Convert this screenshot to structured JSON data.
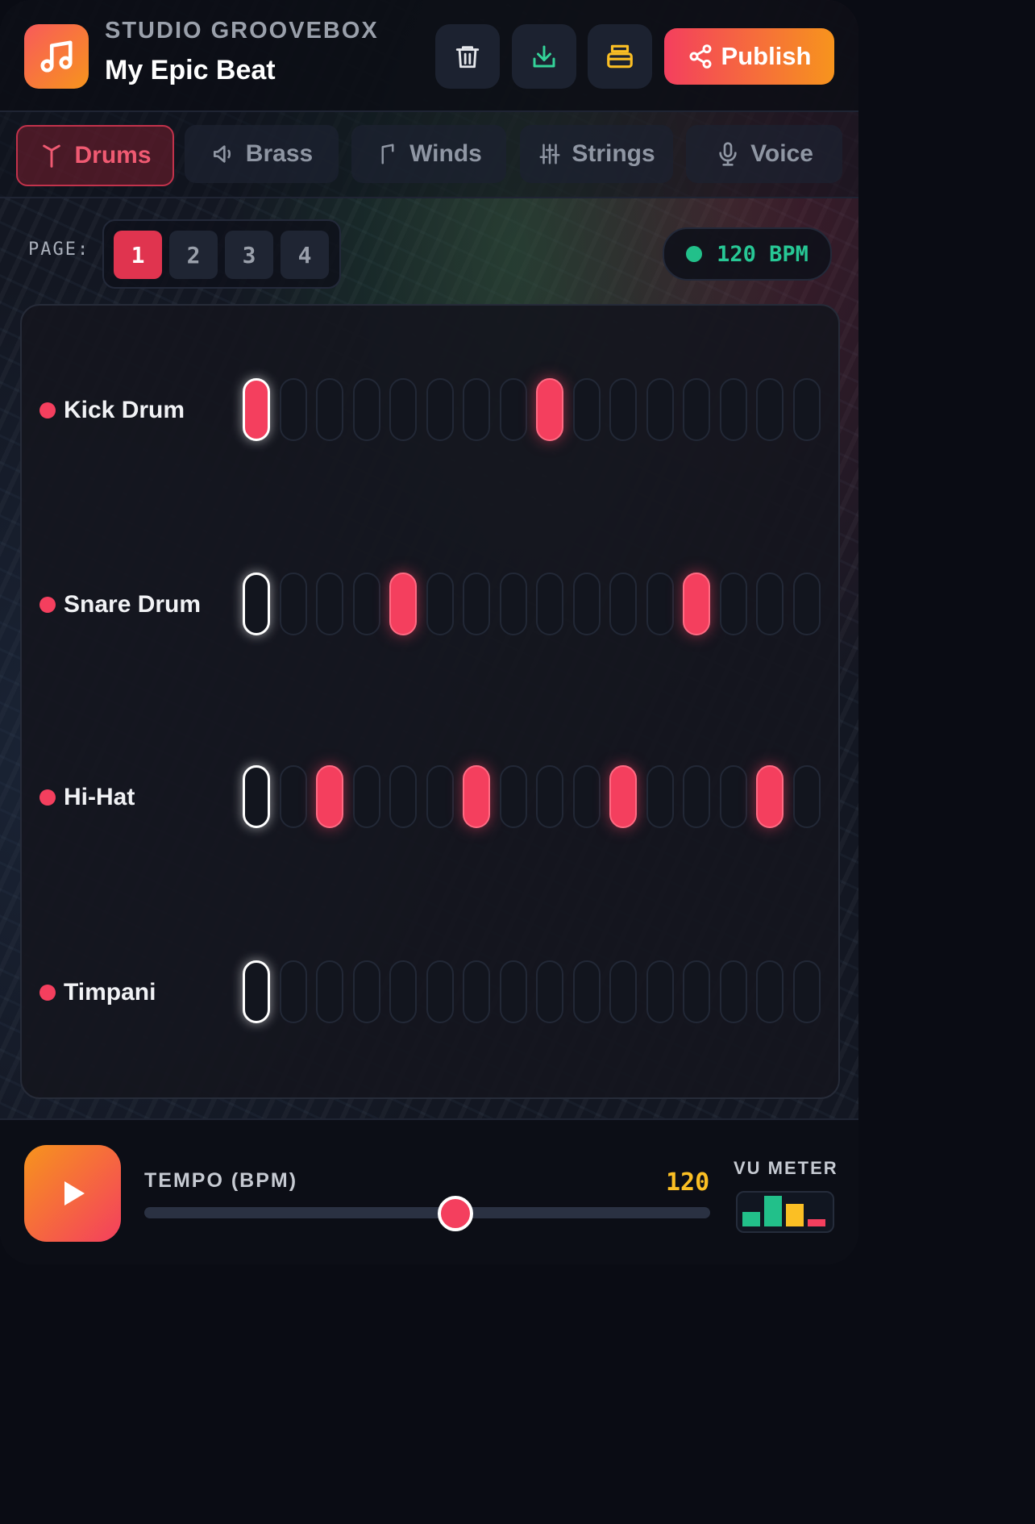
{
  "header": {
    "brand": "STUDIO GROOVEBOX",
    "project_title": "My Epic Beat",
    "actions": [
      {
        "icon": "trash-icon",
        "color": "#e5e7eb"
      },
      {
        "icon": "download-icon",
        "color": "#34d399"
      },
      {
        "icon": "save-icon",
        "color": "#fbbf24"
      }
    ],
    "publish_label": "Publish"
  },
  "tabs": [
    {
      "label": "Drums",
      "icon": "drumstick-icon",
      "active": true
    },
    {
      "label": "Brass",
      "icon": "horn-icon",
      "active": false
    },
    {
      "label": "Winds",
      "icon": "flute-icon",
      "active": false
    },
    {
      "label": "Strings",
      "icon": "sliders-icon",
      "active": false
    },
    {
      "label": "Voice",
      "icon": "microphone-icon",
      "active": false
    }
  ],
  "pager": {
    "label": "PAGE:",
    "pages": [
      "1",
      "2",
      "3",
      "4"
    ],
    "active_page": "1"
  },
  "bpm_badge": "120 BPM",
  "playhead_step": 0,
  "tracks": [
    {
      "name": "Kick Drum",
      "steps": [
        1,
        0,
        0,
        0,
        0,
        0,
        0,
        0,
        1,
        0,
        0,
        0,
        0,
        0,
        0,
        0
      ]
    },
    {
      "name": "Snare Drum",
      "steps": [
        0,
        0,
        0,
        0,
        1,
        0,
        0,
        0,
        0,
        0,
        0,
        0,
        1,
        0,
        0,
        0
      ]
    },
    {
      "name": "Hi-Hat",
      "steps": [
        0,
        0,
        1,
        0,
        0,
        0,
        1,
        0,
        0,
        0,
        1,
        0,
        0,
        0,
        1,
        0
      ]
    },
    {
      "name": "Timpani",
      "steps": [
        0,
        0,
        0,
        0,
        0,
        0,
        0,
        0,
        0,
        0,
        0,
        0,
        0,
        0,
        0,
        0
      ]
    }
  ],
  "transport": {
    "play_icon": "play-icon",
    "tempo_label": "TEMPO (BPM)",
    "tempo_value": "120",
    "tempo_fraction": 0.55
  },
  "vu": {
    "label": "VU METER",
    "levels": [
      {
        "level": 0.45,
        "color": "#22c08a"
      },
      {
        "level": 0.95,
        "color": "#22c08a"
      },
      {
        "level": 0.7,
        "color": "#fbbf24"
      },
      {
        "level": 0.22,
        "color": "#f43f5e"
      }
    ]
  },
  "colors": {
    "accent": "#f43f5e",
    "orange": "#f7941d",
    "green": "#22c08a",
    "yellow": "#fbbf24"
  }
}
